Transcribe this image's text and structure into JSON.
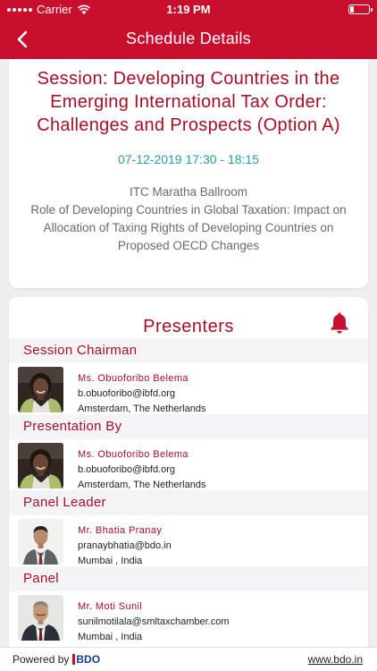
{
  "status": {
    "carrier": "Carrier",
    "time": "1:19 PM"
  },
  "nav": {
    "title": "Schedule Details"
  },
  "session": {
    "title": "Session: Developing Countries in the Emerging International Tax Order: Challenges and Prospects (Option A)",
    "time": "07-12-2019 17:30 - 18:15",
    "venue": "ITC Maratha Ballroom",
    "description": "Role of Developing Countries in Global Taxation: Impact on Allocation of Taxing Rights of Developing Countries on Proposed OECD Changes"
  },
  "presenters": {
    "heading": "Presenters",
    "sections": [
      {
        "label": "Session Chairman",
        "name": "Ms. Obuoforibo Belema",
        "email": "b.obuoforibo@ibfd.org",
        "location": "Amsterdam, The Netherlands"
      },
      {
        "label": "Presentation By",
        "name": "Ms. Obuoforibo Belema",
        "email": "b.obuoforibo@ibfd.org",
        "location": "Amsterdam, The Netherlands"
      },
      {
        "label": "Panel Leader",
        "name": "Mr. Bhatia Pranay",
        "email": "pranaybhatia@bdo.in",
        "location": "Mumbai , India"
      },
      {
        "label": "Panel",
        "name": "Mr. Moti Sunil",
        "email": "sunilmotilala@smltaxchamber.com",
        "location": "Mumbai , India"
      }
    ]
  },
  "footer": {
    "powered_by": "Powered by",
    "logo_text": "BDO",
    "website": "www.bdo.in"
  },
  "colors": {
    "brand": "#c8102e",
    "title_text": "#a50f25",
    "time_text": "#2a9ba0"
  }
}
